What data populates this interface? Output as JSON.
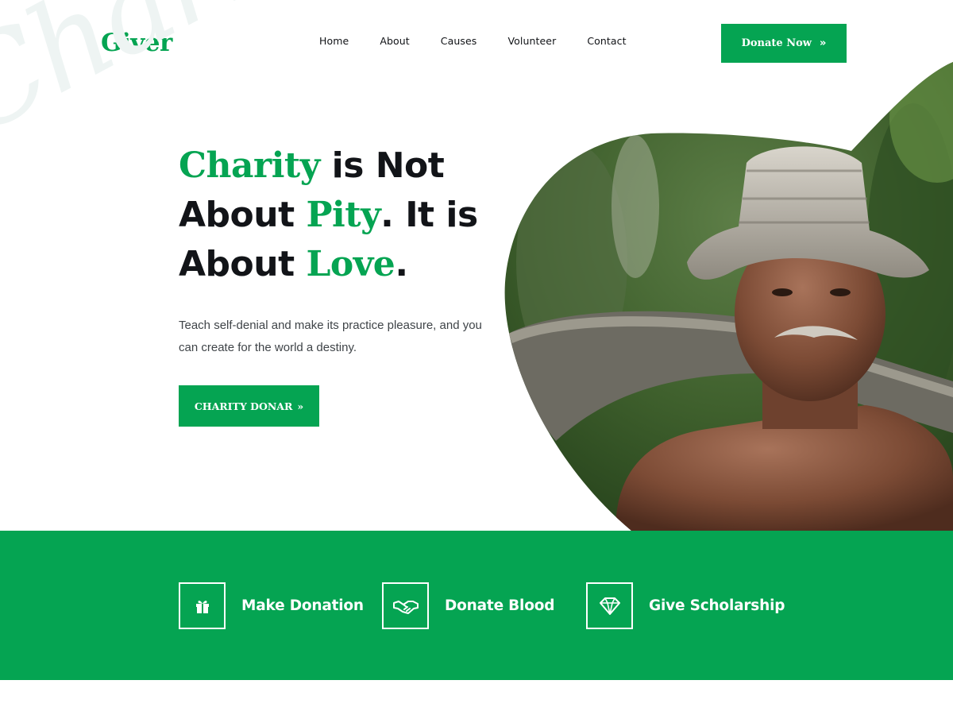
{
  "brand": {
    "logo": "Giver",
    "accent_color": "#05a452"
  },
  "nav": {
    "items": [
      "Home",
      "About",
      "Causes",
      "Volunteer",
      "Contact"
    ]
  },
  "header_button": {
    "label": "Donate Now",
    "icon": "double-chevron-right-icon"
  },
  "hero": {
    "watermark": "Charity",
    "headline": {
      "line1_accent": "Charity",
      "line1_rest": " is Not",
      "line2_pre": "About ",
      "line2_accent": "Pity",
      "line2_rest": ". It is",
      "line3_pre": "About ",
      "line3_accent": "Love",
      "line3_rest": "."
    },
    "lead": "Teach self-denial and make its practice pleasure, and you can create for the world a destiny.",
    "cta": {
      "label": "CHARITY DONAR",
      "icon": "double-chevron-right-icon"
    },
    "image": "elderly-farmer-straw-hat-photo"
  },
  "features": [
    {
      "label": "Make Donation",
      "icon": "gift-icon"
    },
    {
      "label": "Donate Blood",
      "icon": "handshake-icon"
    },
    {
      "label": "Give Scholarship",
      "icon": "diamond-icon"
    }
  ]
}
